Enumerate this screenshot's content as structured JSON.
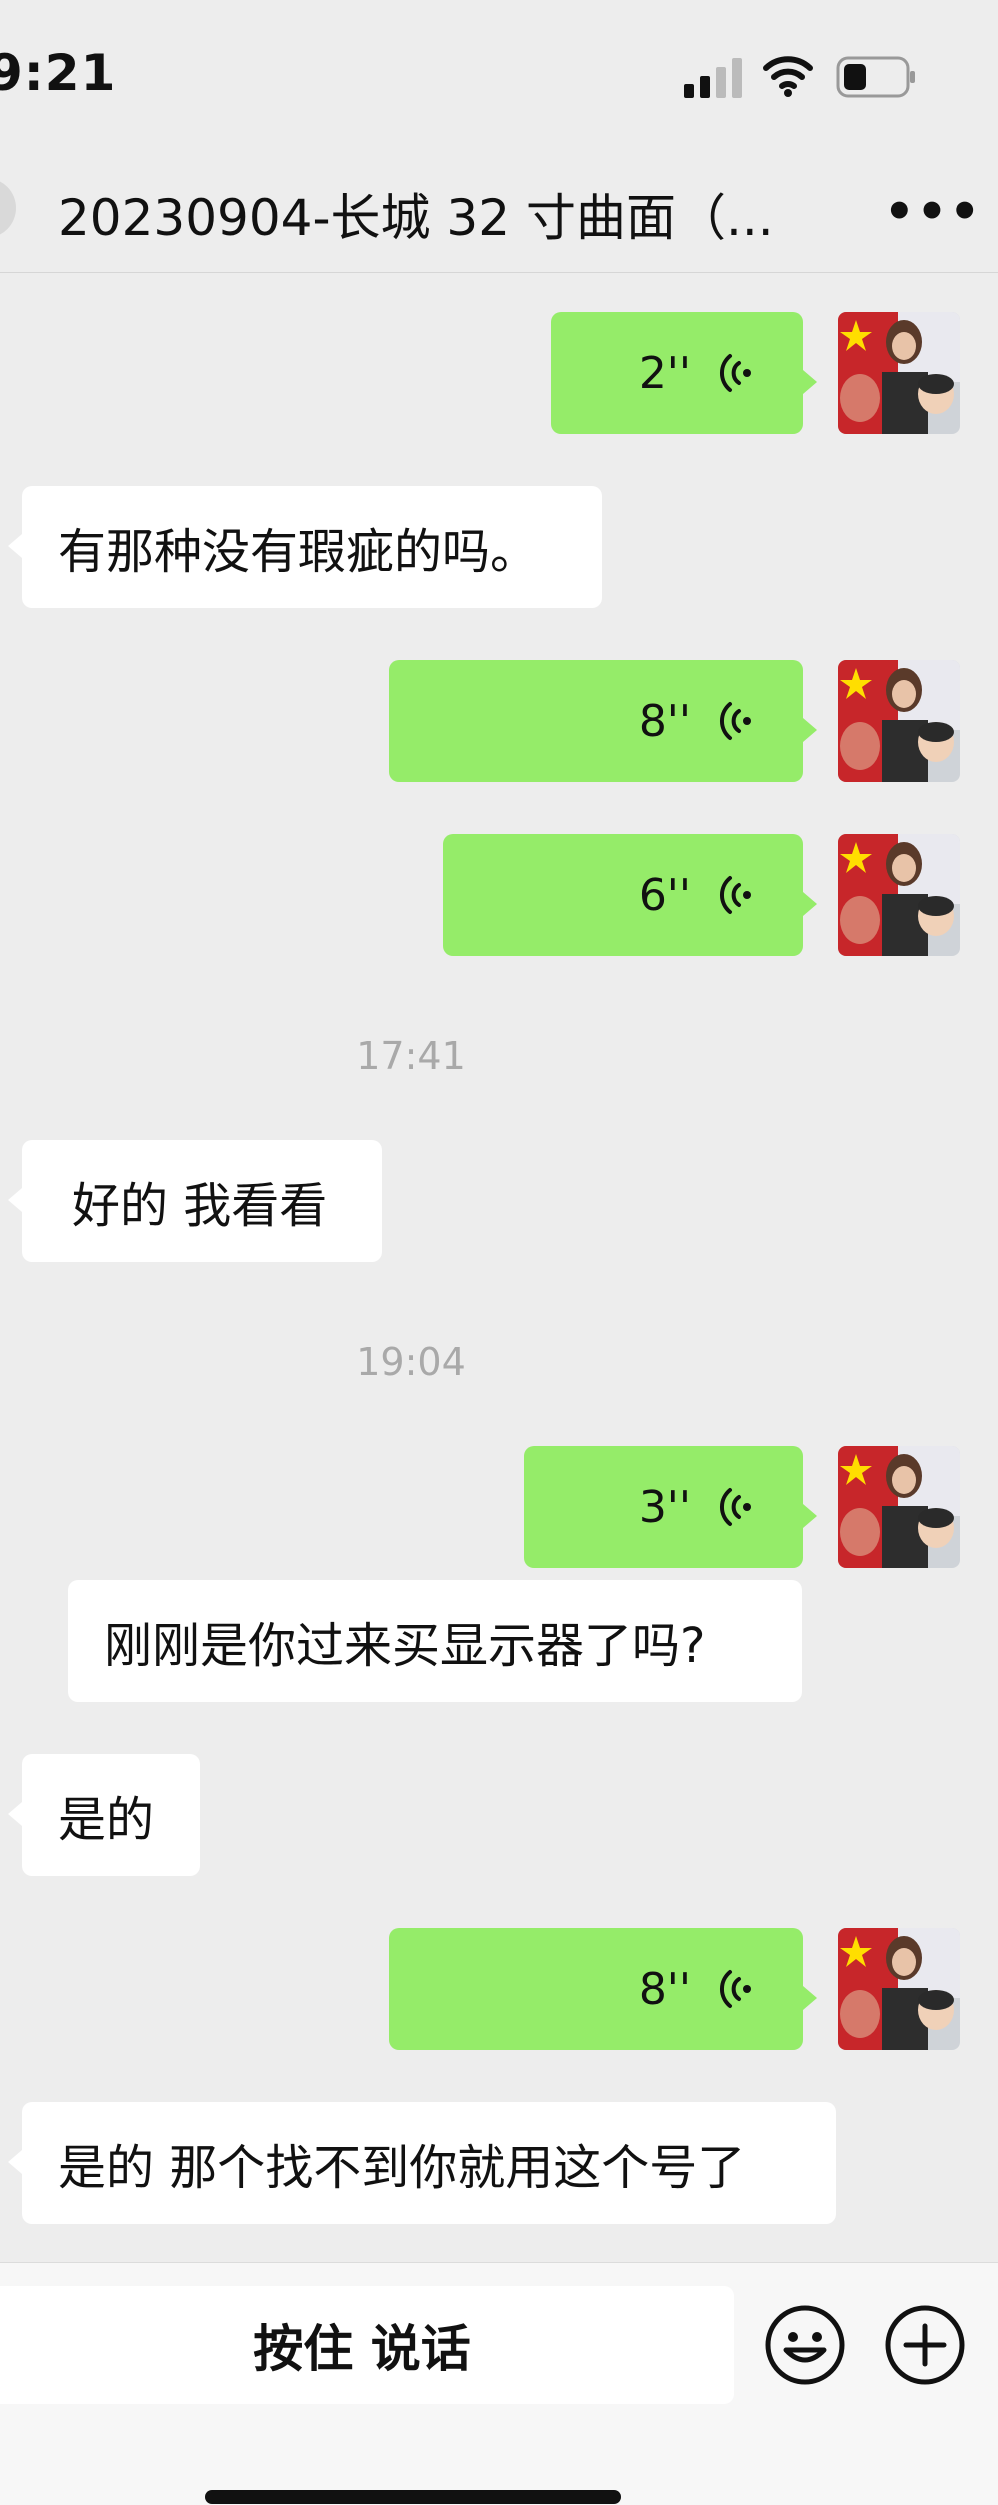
{
  "status_bar": {
    "time": "9:21"
  },
  "header": {
    "title": "20230904-长城 32 寸曲面（...",
    "more": "•••"
  },
  "messages": [
    {
      "type": "voice",
      "side": "out",
      "duration": "2''"
    },
    {
      "type": "text",
      "side": "in",
      "text": "有那种没有瑕疵的吗。"
    },
    {
      "type": "voice",
      "side": "out",
      "duration": "8''"
    },
    {
      "type": "voice",
      "side": "out",
      "duration": "6''"
    },
    {
      "type": "time",
      "text": "17:41"
    },
    {
      "type": "text",
      "side": "in",
      "text": "好的 我看看"
    },
    {
      "type": "time",
      "text": "19:04"
    },
    {
      "type": "voice",
      "side": "out",
      "duration": "3''"
    },
    {
      "type": "text",
      "side": "out_plain",
      "text": "刚刚是你过来买显示器了吗?"
    },
    {
      "type": "text",
      "side": "in",
      "text": "是的"
    },
    {
      "type": "voice",
      "side": "out",
      "duration": "8''"
    },
    {
      "type": "text",
      "side": "in",
      "text": "是的 那个找不到你就用这个号了"
    }
  ],
  "input_bar": {
    "hold_to_talk": "按住 说话"
  },
  "icons": {
    "voice": "voice-wave-icon",
    "emoji": "emoji-icon",
    "plus": "plus-icon",
    "more": "more-icon"
  },
  "colors": {
    "outgoing_bubble": "#95ec69",
    "incoming_bubble": "#ffffff",
    "background": "#ededed"
  }
}
